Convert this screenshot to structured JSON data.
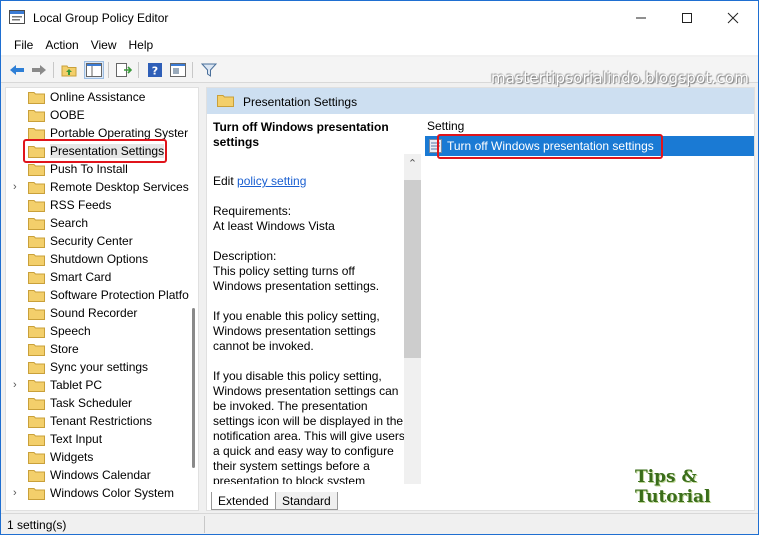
{
  "window": {
    "title": "Local Group Policy Editor"
  },
  "menubar": {
    "items": [
      "File",
      "Action",
      "View",
      "Help"
    ]
  },
  "toolbar": {
    "buttons": [
      "back-icon",
      "forward-icon",
      "up-folder-icon",
      "show-hide-tree-icon",
      "export-list-icon",
      "help-icon",
      "properties-icon",
      "filter-icon"
    ]
  },
  "watermark": {
    "text": "mastertipsorialindo.blogspot.com"
  },
  "tree": {
    "items": [
      {
        "label": "Online Assistance",
        "expandable": false
      },
      {
        "label": "OOBE",
        "expandable": false
      },
      {
        "label": "Portable Operating Syster",
        "expandable": false
      },
      {
        "label": "Presentation Settings",
        "expandable": false,
        "selected": true
      },
      {
        "label": "Push To Install",
        "expandable": false
      },
      {
        "label": "Remote Desktop Services",
        "expandable": true
      },
      {
        "label": "RSS Feeds",
        "expandable": false
      },
      {
        "label": "Search",
        "expandable": false
      },
      {
        "label": "Security Center",
        "expandable": false
      },
      {
        "label": "Shutdown Options",
        "expandable": false
      },
      {
        "label": "Smart Card",
        "expandable": false
      },
      {
        "label": "Software Protection Platfo",
        "expandable": false
      },
      {
        "label": "Sound Recorder",
        "expandable": false
      },
      {
        "label": "Speech",
        "expandable": false
      },
      {
        "label": "Store",
        "expandable": false
      },
      {
        "label": "Sync your settings",
        "expandable": false
      },
      {
        "label": "Tablet PC",
        "expandable": true
      },
      {
        "label": "Task Scheduler",
        "expandable": false
      },
      {
        "label": "Tenant Restrictions",
        "expandable": false
      },
      {
        "label": "Text Input",
        "expandable": false
      },
      {
        "label": "Widgets",
        "expandable": false
      },
      {
        "label": "Windows Calendar",
        "expandable": false
      },
      {
        "label": "Windows Color System",
        "expandable": true
      }
    ]
  },
  "right_pane": {
    "header_title": "Presentation Settings",
    "description": {
      "title": "Turn off Windows presentation settings",
      "edit_prefix": "Edit ",
      "edit_link": "policy setting ",
      "requirements_label": "Requirements:",
      "requirements_value": "At least Windows Vista",
      "description_label": "Description:",
      "description_text": "This policy setting turns off Windows presentation settings.",
      "enable_text": "If you enable this policy setting, Windows presentation settings cannot be invoked.",
      "disable_text": "If you disable this policy setting, Windows presentation settings can be invoked. The presentation settings icon will be displayed in the notification area. This will give users a quick and easy way to configure their system settings before a presentation to block system notifications and screen"
    },
    "list": {
      "column_header": "Setting",
      "rows": [
        {
          "label": "Turn off Windows presentation settings",
          "selected": true
        }
      ]
    },
    "tabs": [
      "Extended",
      "Standard"
    ]
  },
  "overlay": {
    "tips_text": "Tips & Tutorial"
  },
  "statusbar": {
    "text": "1 setting(s)"
  },
  "colors": {
    "accent": "#1a7ad4",
    "header": "#cddff1",
    "highlight_box": "#e0141b",
    "folder": "#f3cf6b"
  }
}
